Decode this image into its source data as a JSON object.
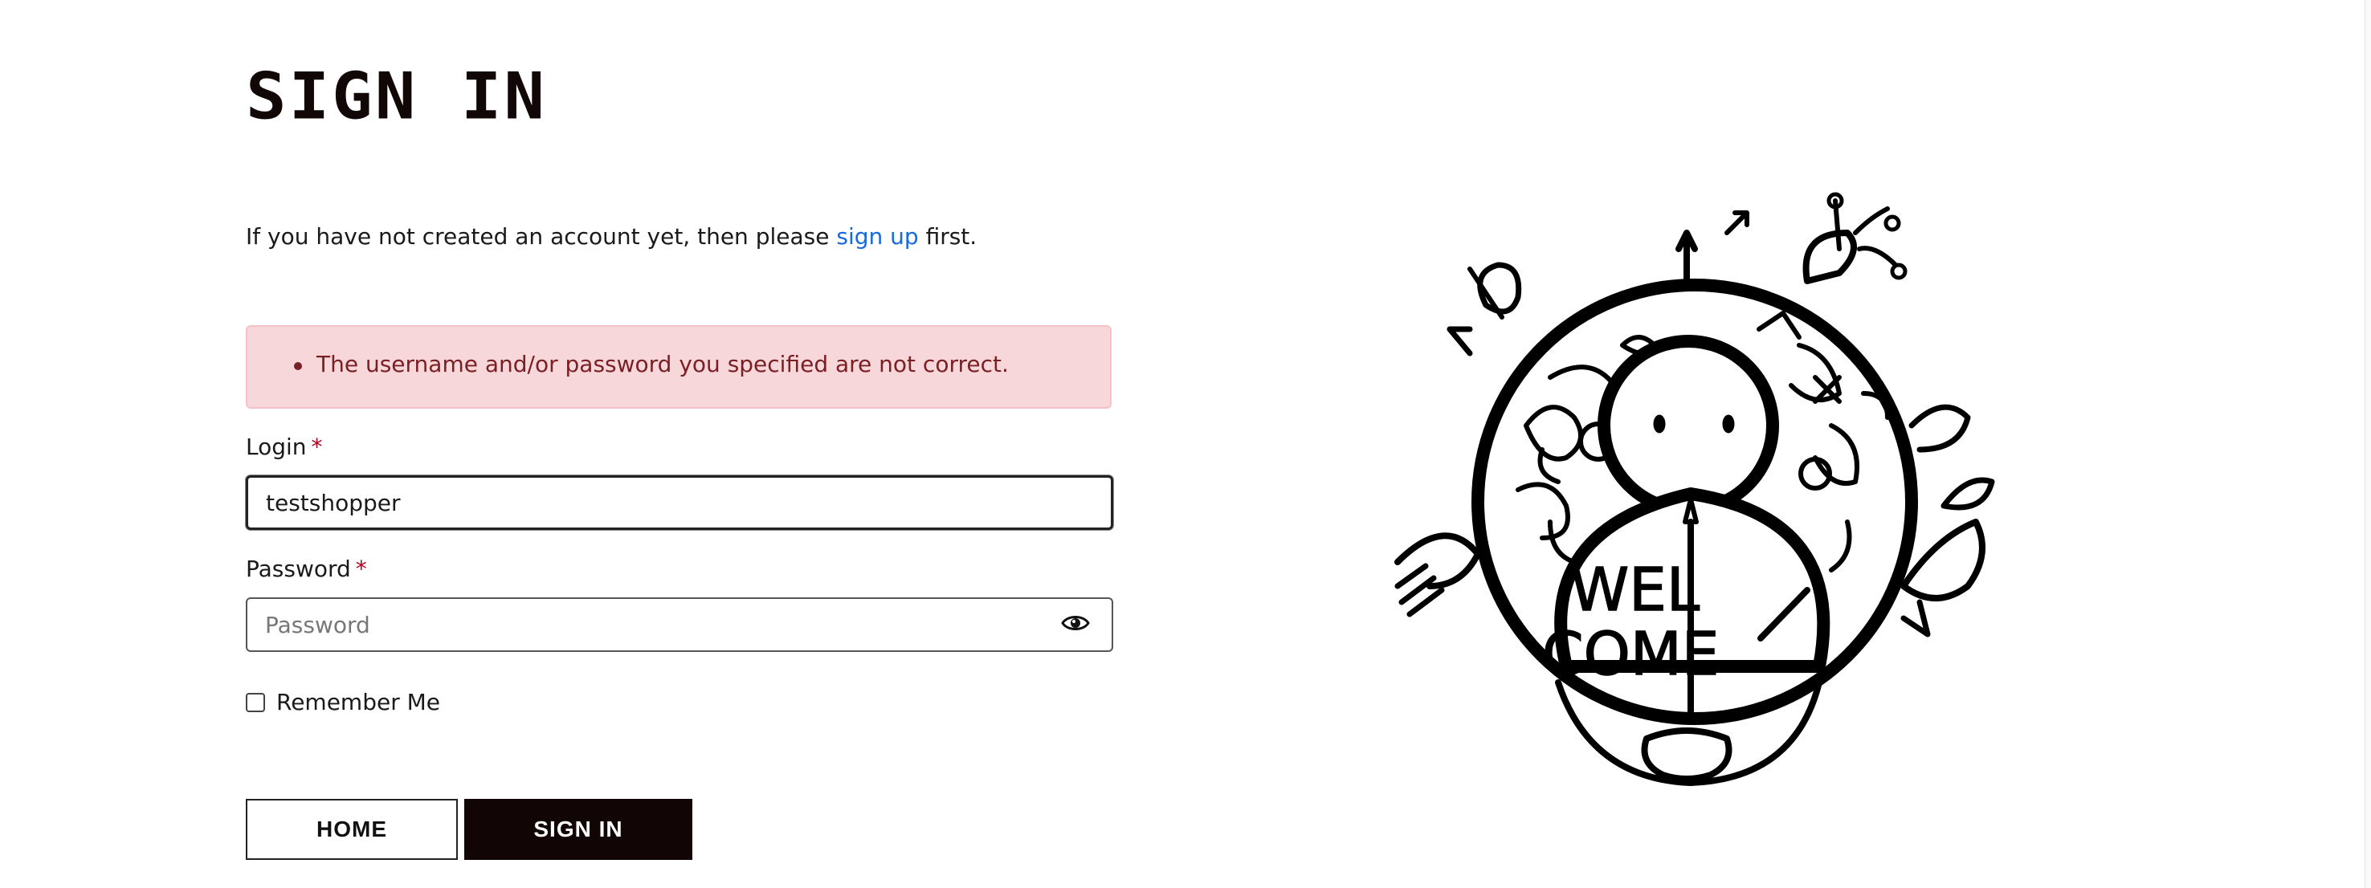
{
  "page": {
    "title": "SIGN IN",
    "intro_before": "If you have not created an account yet, then please ",
    "intro_link": "sign up",
    "intro_after": " first."
  },
  "alert": {
    "message": "The username and/or password you specified are not correct."
  },
  "form": {
    "login_label": "Login",
    "login_value": "testshopper",
    "password_label": "Password",
    "password_placeholder": "Password",
    "required_mark": "*",
    "remember_label": "Remember Me"
  },
  "buttons": {
    "home": "HOME",
    "sign_in": "SIGN IN"
  },
  "illustration": {
    "line1": "WEL",
    "line2": "COME"
  },
  "colors": {
    "link": "#1769e6",
    "alert_bg": "#f8d7da",
    "alert_text": "#7a1f24",
    "required": "#b0001e",
    "primary_button": "#120505"
  },
  "icons": [
    "eye-icon"
  ]
}
